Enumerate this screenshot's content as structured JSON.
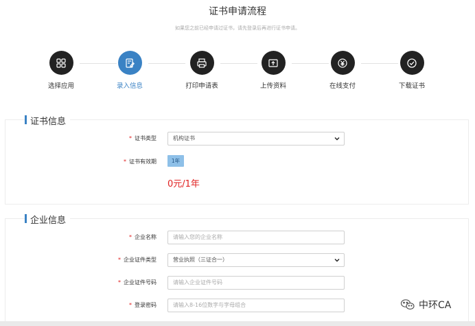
{
  "header": {
    "title": "证书申请流程",
    "subtitle": "如果您之前已经申请过证书，请先登录后再进行证书申请。"
  },
  "steps": [
    {
      "label": "选择应用",
      "icon": "grid-icon",
      "active": false
    },
    {
      "label": "录入信息",
      "icon": "edit-icon",
      "active": true
    },
    {
      "label": "打印申请表",
      "icon": "printer-icon",
      "active": false
    },
    {
      "label": "上传资料",
      "icon": "upload-icon",
      "active": false
    },
    {
      "label": "在线支付",
      "icon": "yen-icon",
      "active": false
    },
    {
      "label": "下载证书",
      "icon": "check-circle-icon",
      "active": false
    }
  ],
  "cert_section": {
    "title": "证书信息",
    "cert_type_label": "证书类型",
    "cert_type_value": "机构证书",
    "validity_label": "证书有效期",
    "validity_value": "1年",
    "price": "0元/1年"
  },
  "company_section": {
    "title": "企业信息",
    "name_label": "企业名称",
    "name_placeholder": "请输入您的企业名称",
    "id_type_label": "企业证件类型",
    "id_type_value": "营业执照（三证合一）",
    "id_number_label": "企业证件号码",
    "id_number_placeholder": "请输入企业证件号码",
    "password_label": "登录密码",
    "password_placeholder": "请输入8-16位数字与字母组合"
  },
  "required_mark": "*",
  "watermark": {
    "text": "中环CA",
    "icon": "wechat-icon"
  },
  "colors": {
    "accent": "#3a82c4",
    "dark": "#222222",
    "required": "#e02020",
    "badge": "#8ec0e8"
  }
}
